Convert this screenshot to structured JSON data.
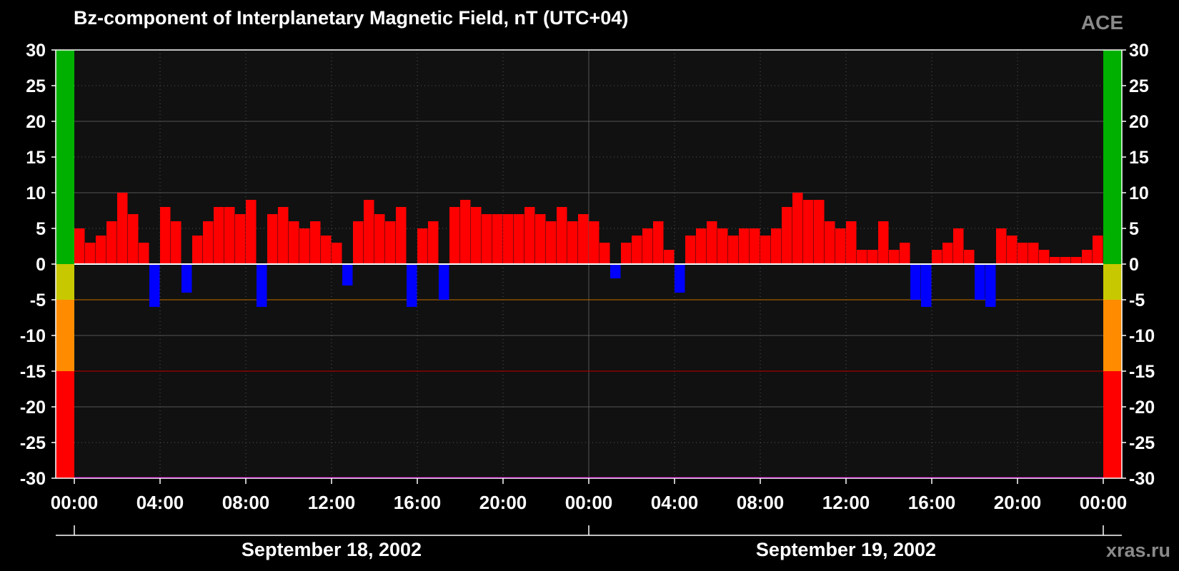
{
  "title": "Bz-component of Interplanetary Magnetic Field, nT (UTC+04)",
  "source_label": "ACE",
  "credit": "xras.ru",
  "colors": {
    "background": "#000000",
    "plot_area": "#111111",
    "positive": "#ff0000",
    "negative": "#0000ff",
    "band_green": "#00b000",
    "band_yellow": "#c8c800",
    "band_orange": "#ff8c00",
    "band_red": "#ff0000",
    "threshold_orange": "#a05a00",
    "threshold_red": "#a00000"
  },
  "chart_data": {
    "type": "bar",
    "title": "Bz-component of Interplanetary Magnetic Field, nT (UTC+04)",
    "ylim": [
      -30,
      30
    ],
    "yticks": [
      30,
      25,
      20,
      15,
      10,
      5,
      0,
      -5,
      -10,
      -15,
      -20,
      -25,
      -30
    ],
    "xlim_hours": [
      0,
      48
    ],
    "xtick_labels": [
      "00:00",
      "04:00",
      "08:00",
      "12:00",
      "16:00",
      "20:00",
      "00:00",
      "04:00",
      "08:00",
      "12:00",
      "16:00",
      "20:00",
      "00:00"
    ],
    "date_labels": [
      "September 18, 2002",
      "September 19, 2002"
    ],
    "color_bands": [
      {
        "from": 0,
        "to": 30,
        "color": "green"
      },
      {
        "from": -5,
        "to": 0,
        "color": "yellow"
      },
      {
        "from": -15,
        "to": -5,
        "color": "orange"
      },
      {
        "from": -30,
        "to": -15,
        "color": "red"
      }
    ],
    "threshold_lines": [
      -5,
      -15
    ],
    "grid": true,
    "series": [
      {
        "color": "red/blue",
        "x_hours": [
          0,
          0.5,
          1,
          1.5,
          2,
          2.5,
          3,
          3.5,
          4,
          4.5,
          5,
          5.5,
          6,
          6.5,
          7,
          7.5,
          8,
          8.5,
          9,
          9.5,
          10,
          10.5,
          11,
          11.5,
          12,
          12.5,
          13,
          13.5,
          14,
          14.5,
          15,
          15.5,
          16,
          16.5,
          17,
          17.5,
          18,
          18.5,
          19,
          19.5,
          20,
          20.5,
          21,
          21.5,
          22,
          22.5,
          23,
          23.5,
          24,
          24.5,
          25,
          25.5,
          26,
          26.5,
          27,
          27.5,
          28,
          28.5,
          29,
          29.5,
          30,
          30.5,
          31,
          31.5,
          32,
          32.5,
          33,
          33.5,
          34,
          34.5,
          35,
          35.5,
          36,
          36.5,
          37,
          37.5,
          38,
          38.5,
          39,
          39.5,
          40,
          40.5,
          41,
          41.5,
          42,
          42.5,
          43,
          43.5,
          44,
          44.5,
          45,
          45.5,
          46,
          46.5,
          47,
          47.5
        ],
        "values": [
          5,
          3,
          4,
          6,
          10,
          7,
          3,
          -6,
          8,
          6,
          -4,
          4,
          6,
          8,
          8,
          7,
          9,
          -6,
          7,
          8,
          6,
          5,
          6,
          4,
          3,
          -3,
          6,
          9,
          7,
          6,
          8,
          -6,
          5,
          6,
          -5,
          8,
          9,
          8,
          7,
          7,
          7,
          7,
          8,
          7,
          6,
          8,
          6,
          7,
          6,
          3,
          -2,
          3,
          4,
          5,
          6,
          2,
          -4,
          4,
          5,
          6,
          5,
          4,
          5,
          5,
          4,
          5,
          8,
          10,
          9,
          9,
          6,
          5,
          6,
          2,
          2,
          6,
          2,
          3,
          -5,
          -6,
          2,
          3,
          5,
          2,
          -5,
          -6,
          5,
          4,
          3,
          3,
          2,
          1,
          1,
          1,
          2,
          4
        ]
      }
    ]
  }
}
